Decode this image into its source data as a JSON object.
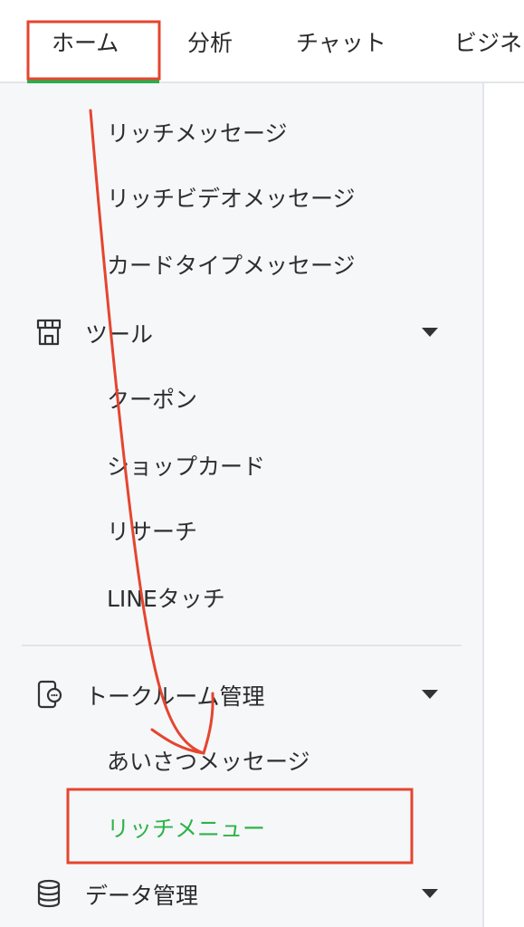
{
  "top_nav": {
    "tabs": [
      "ホーム",
      "分析",
      "チャット",
      "ビジネ"
    ]
  },
  "sidebar": {
    "message_items": [
      "リッチメッセージ",
      "リッチビデオメッセージ",
      "カードタイプメッセージ"
    ],
    "tools": {
      "label": "ツール",
      "items": [
        "クーポン",
        "ショップカード",
        "リサーチ",
        "LINEタッチ"
      ]
    },
    "talkroom": {
      "label": "トークルーム管理",
      "items": [
        "あいさつメッセージ",
        "リッチメニュー"
      ],
      "active_item": "リッチメニュー"
    },
    "data": {
      "label": "データ管理"
    }
  },
  "colors": {
    "accent_green": "#2fb34a",
    "annotation_red": "#e5452f"
  }
}
